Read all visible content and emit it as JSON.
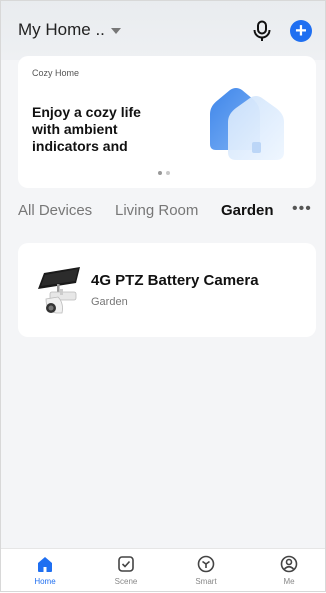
{
  "header": {
    "home_title": "My Home ..",
    "icons": {
      "voice": "microphone-icon",
      "add": "plus-icon"
    },
    "add_symbol": "+"
  },
  "banner": {
    "kicker": "Cozy Home",
    "headline": "Enjoy a cozy life with ambient indicators and",
    "page_count": 2,
    "active_page": 1
  },
  "tabs": {
    "items": [
      "All Devices",
      "Living Room",
      "Garden"
    ],
    "active": "Garden",
    "more_symbol": "•••"
  },
  "devices": [
    {
      "name": "4G PTZ Battery Camera",
      "room": "Garden",
      "icon": "solar-ptz-camera-icon"
    }
  ],
  "tabbar": {
    "items": [
      {
        "label": "Home",
        "icon": "home-icon",
        "active": true
      },
      {
        "label": "Scene",
        "icon": "scene-checkbox-icon",
        "active": false
      },
      {
        "label": "Smart",
        "icon": "smart-cube-icon",
        "active": false
      },
      {
        "label": "Me",
        "icon": "profile-icon",
        "active": false
      }
    ]
  },
  "colors": {
    "accent": "#1f6ff1",
    "background": "#f4f5f7",
    "card": "#ffffff"
  }
}
